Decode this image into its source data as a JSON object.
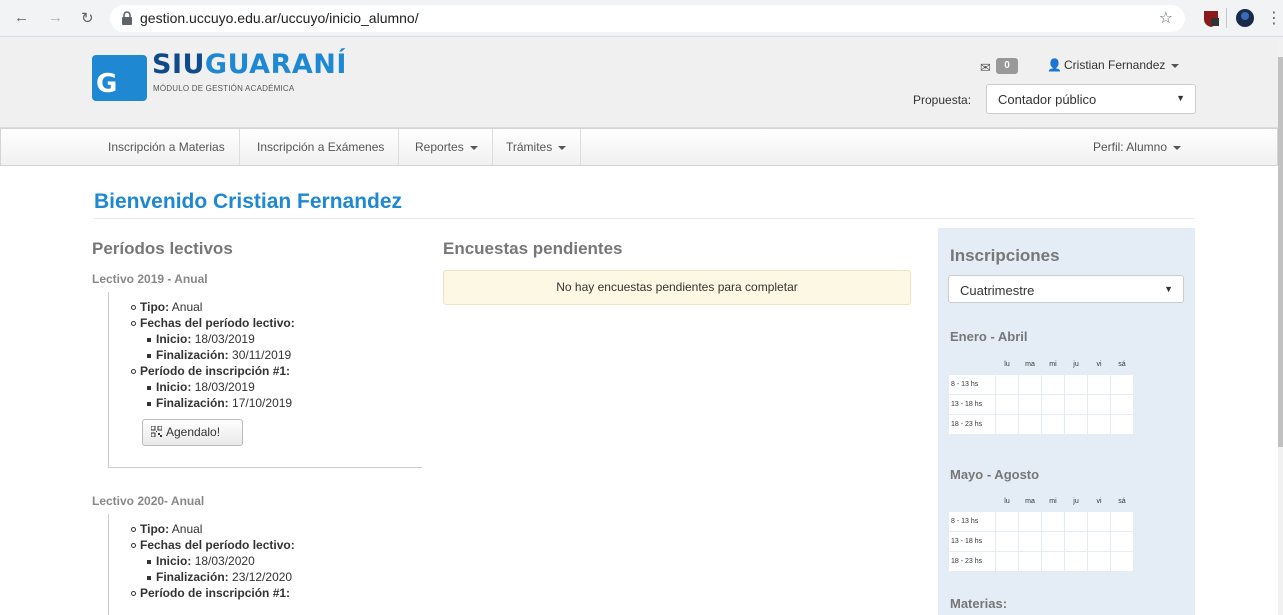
{
  "browser": {
    "url": "gestion.uccuyo.edu.ar/uccuyo/inicio_alumno/"
  },
  "header": {
    "logo_siu": "SIU",
    "logo_guarani": "GUARANÍ",
    "logo_letter": "G",
    "logo_subtitle": "MÓDULO DE GESTIÓN ACADÉMICA",
    "messages_count": "0",
    "user_name": "Cristian Fernandez",
    "propuesta_label": "Propuesta:",
    "propuesta_value": "Contador público"
  },
  "nav": {
    "items": [
      "Inscripción a Materias",
      "Inscripción a Exámenes",
      "Reportes",
      "Trámites"
    ],
    "perfil": "Perfil: Alumno"
  },
  "main": {
    "welcome": "Bienvenido Cristian Fernandez",
    "periodos_heading": "Períodos lectivos",
    "periodos": [
      {
        "title": "Lectivo 2019 - Anual",
        "tipo_label": "Tipo:",
        "tipo": "Anual",
        "fechas_label": "Fechas del período lectivo:",
        "inicio_label": "Inicio:",
        "inicio": "18/03/2019",
        "fin_label": "Finalización:",
        "fin": "30/11/2019",
        "insc_label": "Período de inscripción #1:",
        "insc_inicio": "18/03/2019",
        "insc_fin": "17/10/2019",
        "agenda_button": "Agendalo!"
      },
      {
        "title": "Lectivo 2020- Anual",
        "tipo_label": "Tipo:",
        "tipo": "Anual",
        "fechas_label": "Fechas del período lectivo:",
        "inicio_label": "Inicio:",
        "inicio": "18/03/2020",
        "fin_label": "Finalización:",
        "fin": "23/12/2020",
        "insc_label": "Período de inscripción #1:"
      }
    ],
    "encuestas_heading": "Encuestas pendientes",
    "encuestas_message": "No hay encuestas pendientes para completar"
  },
  "sidebar": {
    "heading": "Inscripciones",
    "select_value": "Cuatrimestre",
    "schedules": [
      {
        "label": "Enero - Abril"
      },
      {
        "label": "Mayo - Agosto"
      }
    ],
    "days": [
      "lu",
      "ma",
      "mi",
      "ju",
      "vi",
      "sá"
    ],
    "slots": [
      "8 - 13 hs",
      "13 - 18 hs",
      "18 - 23 hs"
    ],
    "materias_heading": "Materias:"
  },
  "colors": {
    "brand_blue": "#1e88d3",
    "brand_dark": "#0f4a8a",
    "sidebar_bg": "#e4edf5",
    "alert_bg": "#fcf8e3"
  }
}
